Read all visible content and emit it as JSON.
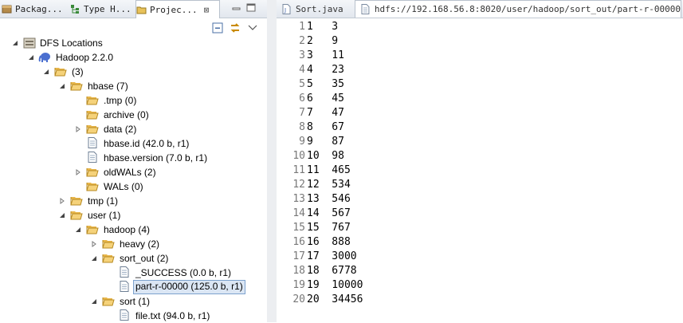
{
  "left_tabs": [
    {
      "label": "Packag..."
    },
    {
      "label": "Type H..."
    },
    {
      "label": "Projec...",
      "close": "⊠"
    }
  ],
  "tree": {
    "root": "DFS Locations",
    "server": "Hadoop 2.2.0",
    "top": "(3)",
    "hbase": "hbase (7)",
    "tmp_hbase": ".tmp (0)",
    "archive": "archive (0)",
    "data": "data (2)",
    "hbase_id": "hbase.id (42.0 b, r1)",
    "hbase_version": "hbase.version (7.0 b, r1)",
    "oldwals": "oldWALs (2)",
    "wals": "WALs (0)",
    "tmp": "tmp (1)",
    "user": "user (1)",
    "hadoop": "hadoop (4)",
    "heavy": "heavy (2)",
    "sort_out": "sort_out (2)",
    "success": "_SUCCESS (0.0 b, r1)",
    "part": "part-r-00000 (125.0 b, r1)",
    "sort": "sort (1)",
    "file": "file.txt (94.0 b, r1)"
  },
  "editor_tabs": [
    {
      "label": "Sort.java"
    },
    {
      "label": "hdfs://192.168.56.8:8020/user/hadoop/sort_out/part-r-00000"
    }
  ],
  "editor_lines": [
    {
      "num": "1",
      "text": "1   3"
    },
    {
      "num": "2",
      "text": "2   9"
    },
    {
      "num": "3",
      "text": "3   11"
    },
    {
      "num": "4",
      "text": "4   23"
    },
    {
      "num": "5",
      "text": "5   35"
    },
    {
      "num": "6",
      "text": "6   45"
    },
    {
      "num": "7",
      "text": "7   47"
    },
    {
      "num": "8",
      "text": "8   67"
    },
    {
      "num": "9",
      "text": "9   87"
    },
    {
      "num": "10",
      "text": "10  98"
    },
    {
      "num": "11",
      "text": "11  465"
    },
    {
      "num": "12",
      "text": "12  534"
    },
    {
      "num": "13",
      "text": "13  546"
    },
    {
      "num": "14",
      "text": "14  567"
    },
    {
      "num": "15",
      "text": "15  767"
    },
    {
      "num": "16",
      "text": "16  888"
    },
    {
      "num": "17",
      "text": "17  3000"
    },
    {
      "num": "18",
      "text": "18  6778"
    },
    {
      "num": "19",
      "text": "19  10000"
    },
    {
      "num": "20",
      "text": "20  34456"
    }
  ],
  "colors": {
    "selection_bg": "#dbe6f4",
    "selection_border": "#7da2ce",
    "folder": "#e8b64a"
  }
}
